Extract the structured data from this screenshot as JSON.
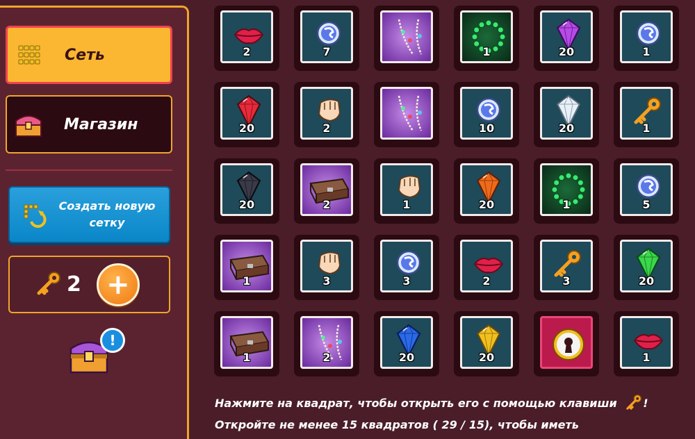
{
  "sidebar": {
    "grid_label": "Сеть",
    "shop_label": "Магазин",
    "create_label": "Создать новую сетку",
    "keys_count": "2",
    "notify_badge": "!"
  },
  "icons": {
    "grid": "grid-icon",
    "shop": "treasure-chest-icon",
    "create": "refresh-grid-icon",
    "key": "key-icon",
    "plus": "plus-icon"
  },
  "colors": {
    "accent": "#f0a62a",
    "active_nav": "#fbb731",
    "create_button": "#0a86c8",
    "tile": "#1e4a5a",
    "locked_tile": "#bb1a4c"
  },
  "grid": {
    "rows": [
      [
        {
          "item": "lips",
          "qty": "2"
        },
        {
          "item": "orb",
          "qty": "7"
        },
        {
          "item": "necklace",
          "qty": ""
        },
        {
          "item": "gem-circle",
          "qty": "1"
        },
        {
          "item": "gem-purple",
          "qty": "20"
        },
        {
          "item": "orb",
          "qty": "1"
        }
      ],
      [
        {
          "item": "gem-red",
          "qty": "20"
        },
        {
          "item": "fist",
          "qty": "2"
        },
        {
          "item": "necklace",
          "qty": ""
        },
        {
          "item": "orb",
          "qty": "10"
        },
        {
          "item": "gem-white",
          "qty": "20"
        },
        {
          "item": "key",
          "qty": "1"
        }
      ],
      [
        {
          "item": "gem-black",
          "qty": "20"
        },
        {
          "item": "book",
          "qty": "2"
        },
        {
          "item": "fist",
          "qty": "1"
        },
        {
          "item": "gem-orange",
          "qty": "20"
        },
        {
          "item": "gem-circle",
          "qty": "1"
        },
        {
          "item": "orb",
          "qty": "5"
        }
      ],
      [
        {
          "item": "book",
          "qty": "1"
        },
        {
          "item": "fist",
          "qty": "3"
        },
        {
          "item": "orb",
          "qty": "3"
        },
        {
          "item": "lips",
          "qty": "2"
        },
        {
          "item": "key",
          "qty": "3"
        },
        {
          "item": "gem-green",
          "qty": "20"
        }
      ],
      [
        {
          "item": "book",
          "qty": "1"
        },
        {
          "item": "necklace",
          "qty": "2"
        },
        {
          "item": "gem-blue",
          "qty": "20"
        },
        {
          "item": "gem-yellow",
          "qty": "20"
        },
        {
          "item": "locked",
          "qty": ""
        },
        {
          "item": "lips",
          "qty": "1"
        }
      ]
    ]
  },
  "info": {
    "line1": "Нажмите на квадрат, чтобы открыть его с помощью клавиши",
    "line1_suffix": "!",
    "line2": "Откройте не менее 15 квадратов ( 29 / 15), чтобы иметь"
  }
}
